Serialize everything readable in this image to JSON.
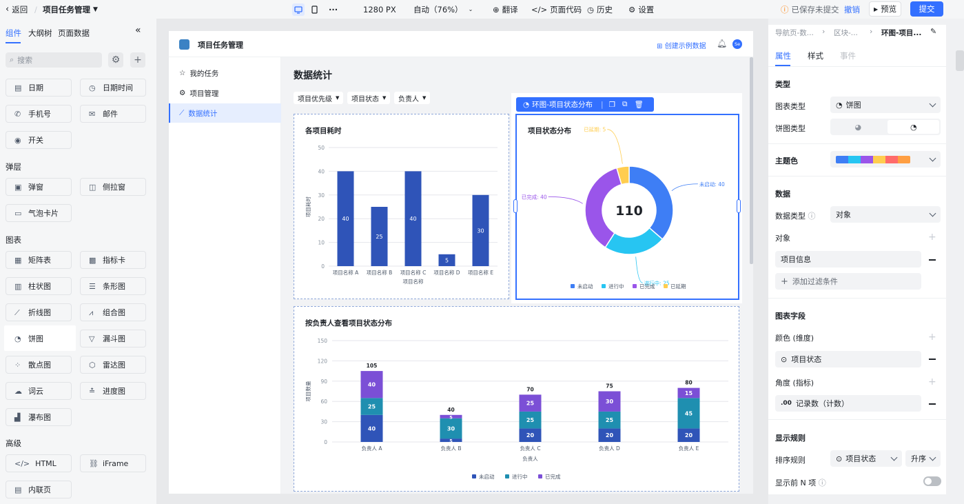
{
  "topbar": {
    "back_label": "返回",
    "app_title": "项目任务管理",
    "width_label": "1280 PX",
    "zoom_label": "自动（76%）",
    "translate_label": "翻译",
    "code_label": "页面代码",
    "history_label": "历史",
    "settings_label": "设置",
    "save_status": "已保存未提交",
    "undo_label": "撤销",
    "preview_label": "预览",
    "submit_label": "提交"
  },
  "leftpanel": {
    "tabs": [
      "组件",
      "大纲树",
      "页面数据"
    ],
    "search_placeholder": "搜索",
    "items": {
      "date": "日期",
      "datetime": "日期时间",
      "phone": "手机号",
      "email": "邮件",
      "switch": "开关",
      "group_popup": "弹层",
      "dialog": "弹窗",
      "drawer": "侧拉窗",
      "bubble": "气泡卡片",
      "group_chart": "图表",
      "matrix": "矩阵表",
      "metric": "指标卡",
      "column": "柱状图",
      "bar": "条形图",
      "line": "折线图",
      "combo": "组合图",
      "pie": "饼图",
      "funnel": "漏斗图",
      "scatter": "散点图",
      "radar": "雷达图",
      "wordcloud": "词云",
      "progress": "进度图",
      "waterfall": "瀑布图",
      "group_advanced": "高级",
      "html": "HTML",
      "iframe": "iFrame",
      "inline": "内联页"
    }
  },
  "app": {
    "title": "项目任务管理",
    "create_sample": "创建示例数据",
    "avatar": "Se",
    "nav": [
      "我的任务",
      "项目管理",
      "数据统计"
    ],
    "page_title": "数据统计",
    "filters": [
      "项目优先级",
      "项目状态",
      "负责人"
    ]
  },
  "selection": {
    "label": "环图-项目状态分布"
  },
  "chart_data": [
    {
      "type": "bar",
      "title": "各项目耗时",
      "xlabel": "项目名称",
      "ylabel": "项目耗时",
      "categories": [
        "项目名称 A",
        "项目名称 B",
        "项目名称 C",
        "项目名称 D",
        "项目名称 E"
      ],
      "values": [
        40,
        25,
        40,
        5,
        30
      ],
      "ylim": [
        0,
        50
      ],
      "yticks": [
        0,
        10,
        20,
        30,
        40,
        50
      ],
      "color": "#2f54b8",
      "grid": true
    },
    {
      "type": "pie",
      "title": "项目状态分布",
      "center_value": "110",
      "slices": [
        {
          "name": "未启动",
          "value": 40,
          "color": "#3e7ef5",
          "label": "未启动: 40"
        },
        {
          "name": "进行中",
          "value": 25,
          "color": "#27c5f2",
          "label": "进行中: 25"
        },
        {
          "name": "已完成",
          "value": 40,
          "color": "#9a55ea",
          "label": "已完成: 40"
        },
        {
          "name": "已延期",
          "value": 5,
          "color": "#ffcd4f",
          "label": "已延期: 5"
        }
      ],
      "legend": "bottom"
    },
    {
      "type": "bar",
      "stacked": true,
      "title": "按负责人查看项目状态分布",
      "xlabel": "负责人",
      "ylabel": "项目数量",
      "categories": [
        "负责人 A",
        "负责人 B",
        "负责人 C",
        "负责人 D",
        "负责人 E"
      ],
      "ylim": [
        0,
        150
      ],
      "yticks": [
        0,
        30,
        60,
        90,
        120,
        150
      ],
      "totals": [
        105,
        40,
        70,
        75,
        80
      ],
      "series": [
        {
          "name": "未启动",
          "values": [
            40,
            5,
            20,
            20,
            20
          ],
          "color": "#2f54b8"
        },
        {
          "name": "进行中",
          "values": [
            25,
            30,
            25,
            25,
            45
          ],
          "color": "#1f8fb0"
        },
        {
          "name": "已完成",
          "values": [
            40,
            5,
            25,
            30,
            15
          ],
          "color": "#7b4fd6"
        }
      ],
      "legend": "bottom"
    }
  ],
  "rightpanel": {
    "breadcrumb": [
      "导航页-数...",
      "区块-...",
      "环图-项目..."
    ],
    "tabs": [
      "属性",
      "样式",
      "事件"
    ],
    "section_type": "类型",
    "chart_type_label": "图表类型",
    "chart_type_value": "饼图",
    "pie_type_label": "饼图类型",
    "theme_label": "主题色",
    "theme_colors": [
      "#3e7ef5",
      "#27c5f2",
      "#9a55ea",
      "#ffcd4f",
      "#ff6b6b",
      "#ff9f43"
    ],
    "section_data": "数据",
    "data_type_label": "数据类型",
    "data_type_value": "对象",
    "object_label": "对象",
    "object_value": "项目信息",
    "add_filter": "添加过滤条件",
    "section_fields": "图表字段",
    "color_dim_label": "颜色 (维度)",
    "color_dim_value": "项目状态",
    "angle_label": "角度 (指标)",
    "angle_value": "记录数（计数）",
    "angle_prefix": ".00",
    "section_display": "显示规则",
    "sort_label": "排序规则",
    "sort_field": "项目状态",
    "sort_order": "升序",
    "topn_label": "显示前 N 项"
  }
}
